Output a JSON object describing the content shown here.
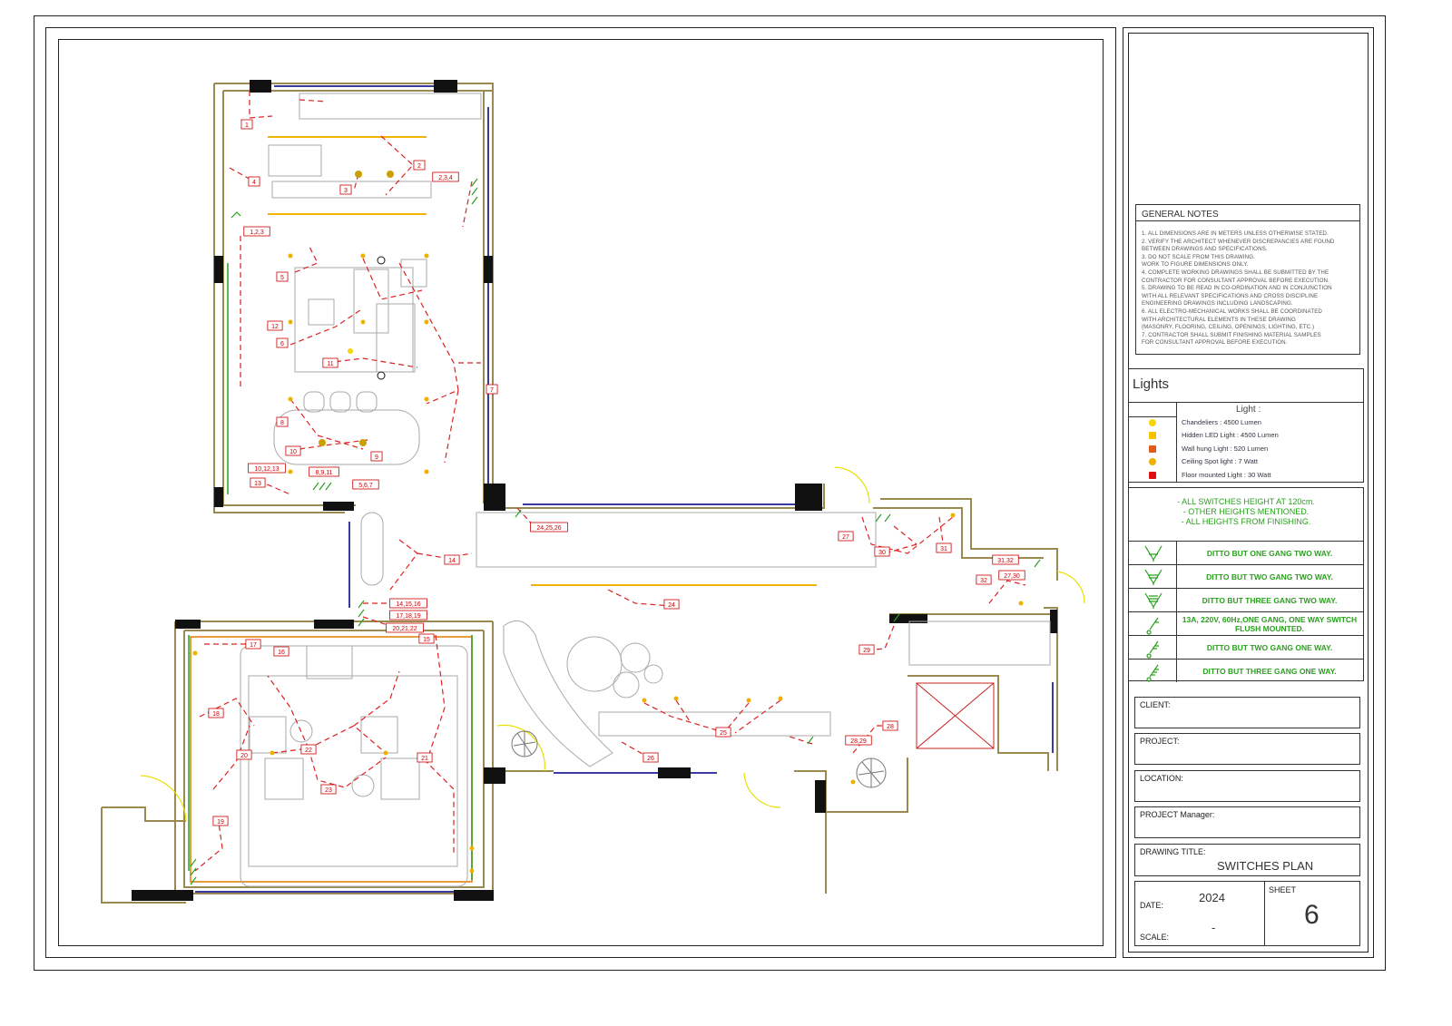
{
  "general_notes": {
    "title": "GENERAL NOTES",
    "lines": [
      "1.    ALL DIMENSIONS ARE IN METERS UNLESS OTHERWISE STATED.",
      "2.    VERIFY THE ARCHITECT WHENEVER DISCREPANCIES ARE FOUND",
      "        BETWEEN DRAWINGS AND SPECIFICATIONS.",
      "3.    DO NOT SCALE FROM THIS DRAWING.",
      "        WORK TO FIGURE DIMENSIONS ONLY.",
      "4.    COMPLETE WORKING DRAWINGS SHALL BE SUBMITTED BY THE",
      "        CONTRACTOR FOR CONSULTANT APPROVAL BEFORE EXECUTION.",
      "5.    DRAWING TO BE READ IN CO-ORDINATION AND IN CONJUNCTION",
      "        WITH ALL RELEVANT SPECIFICATIONS AND CROSS DISCIPLINE",
      "        ENGINEERING DRAWINGS INCLUDING LANDSCAPING.",
      "6.    ALL ELECTRO-MECHANICAL WORKS SHALL BE COORDINATED",
      "        WITH ARCHITECTURAL ELEMENTS IN THESE DRAWING",
      "        (MASONRY, FLOORING, CEILING, OPENINGS, LIGHTING, ETC.)",
      "7.    CONTRACTOR SHALL SUBMIT FINISHING MATERIAL SAMPLES",
      "        FOR CONSULTANT APPROVAL BEFORE EXECUTION."
    ]
  },
  "lights": {
    "title": "Lights",
    "header": "Light :",
    "items": [
      {
        "label": "Chandeliers          : 4500 Lumen",
        "icon": "chandelier-icon",
        "color": "#f5d60a"
      },
      {
        "label": "Hidden LED Light : 4500 Lumen",
        "icon": "hidden-led-icon",
        "color": "#f3c300"
      },
      {
        "label": "Wall hung Light    : 520   Lumen",
        "icon": "wall-light-icon",
        "color": "#e05a1a"
      },
      {
        "label": "Ceiling Spot light  : 7 Watt",
        "icon": "spot-light-icon",
        "color": "#f0b000"
      },
      {
        "label": "Floor mounted Light :  30 Watt",
        "icon": "floor-light-icon",
        "color": "#e01010"
      }
    ]
  },
  "switch_notes": [
    "- ALL SWITCHES HEIGHT AT 120cm.",
    "- OTHER HEIGHTS MENTIONED.",
    "- ALL HEIGHTS FROM FINISHING."
  ],
  "switch_legend": [
    {
      "label": "DITTO BUT ONE GANG TWO WAY.",
      "icon": "switch-one-gang-two-way-icon"
    },
    {
      "label": "DITTO BUT TWO GANG TWO WAY.",
      "icon": "switch-two-gang-two-way-icon"
    },
    {
      "label": "DITTO BUT THREE GANG TWO WAY.",
      "icon": "switch-three-gang-two-way-icon"
    },
    {
      "label": "13A, 220V, 60Hz,ONE GANG, ONE WAY SWITCH FLUSH MOUNTED.",
      "icon": "switch-one-gang-one-way-icon"
    },
    {
      "label": "DITTO BUT TWO GANG ONE WAY.",
      "icon": "switch-two-gang-one-way-icon"
    },
    {
      "label": "DITTO BUT THREE GANG ONE WAY.",
      "icon": "switch-three-gang-one-way-icon"
    }
  ],
  "title_block": {
    "client_label": "CLIENT:",
    "project_label": "PROJECT:",
    "location_label": "LOCATION:",
    "manager_label": "PROJECT Manager:",
    "drawing_title_label": "DRAWING TITLE:",
    "drawing_title": "SWITCHES PLAN",
    "date_label": "DATE:",
    "date": "2024",
    "scale_label": "SCALE:",
    "scale": "-",
    "sheet_label": "SHEET",
    "sheet": "6"
  },
  "plan_tags": [
    "1",
    "2",
    "3",
    "4",
    "5",
    "6",
    "7",
    "8",
    "9",
    "10",
    "11",
    "12",
    "13",
    "14",
    "15",
    "16",
    "17",
    "18",
    "19",
    "20",
    "21",
    "22",
    "23",
    "24",
    "25",
    "26",
    "27",
    "28",
    "29",
    "30",
    "31",
    "32",
    "2,3,4",
    "10,12,13",
    "24,25,26",
    "27,30",
    "31,32",
    "14,15,16",
    "17,18,19",
    "20,21,22",
    "28,29",
    "8,9,11",
    "5,6,7",
    "1,2,3"
  ],
  "colors": {
    "wiring": "#d22",
    "wall": "#9a8a50",
    "window": "#3a3aa0",
    "switch": "#2aa01e",
    "hidden_led": "#f0b400",
    "text": "#333333"
  }
}
